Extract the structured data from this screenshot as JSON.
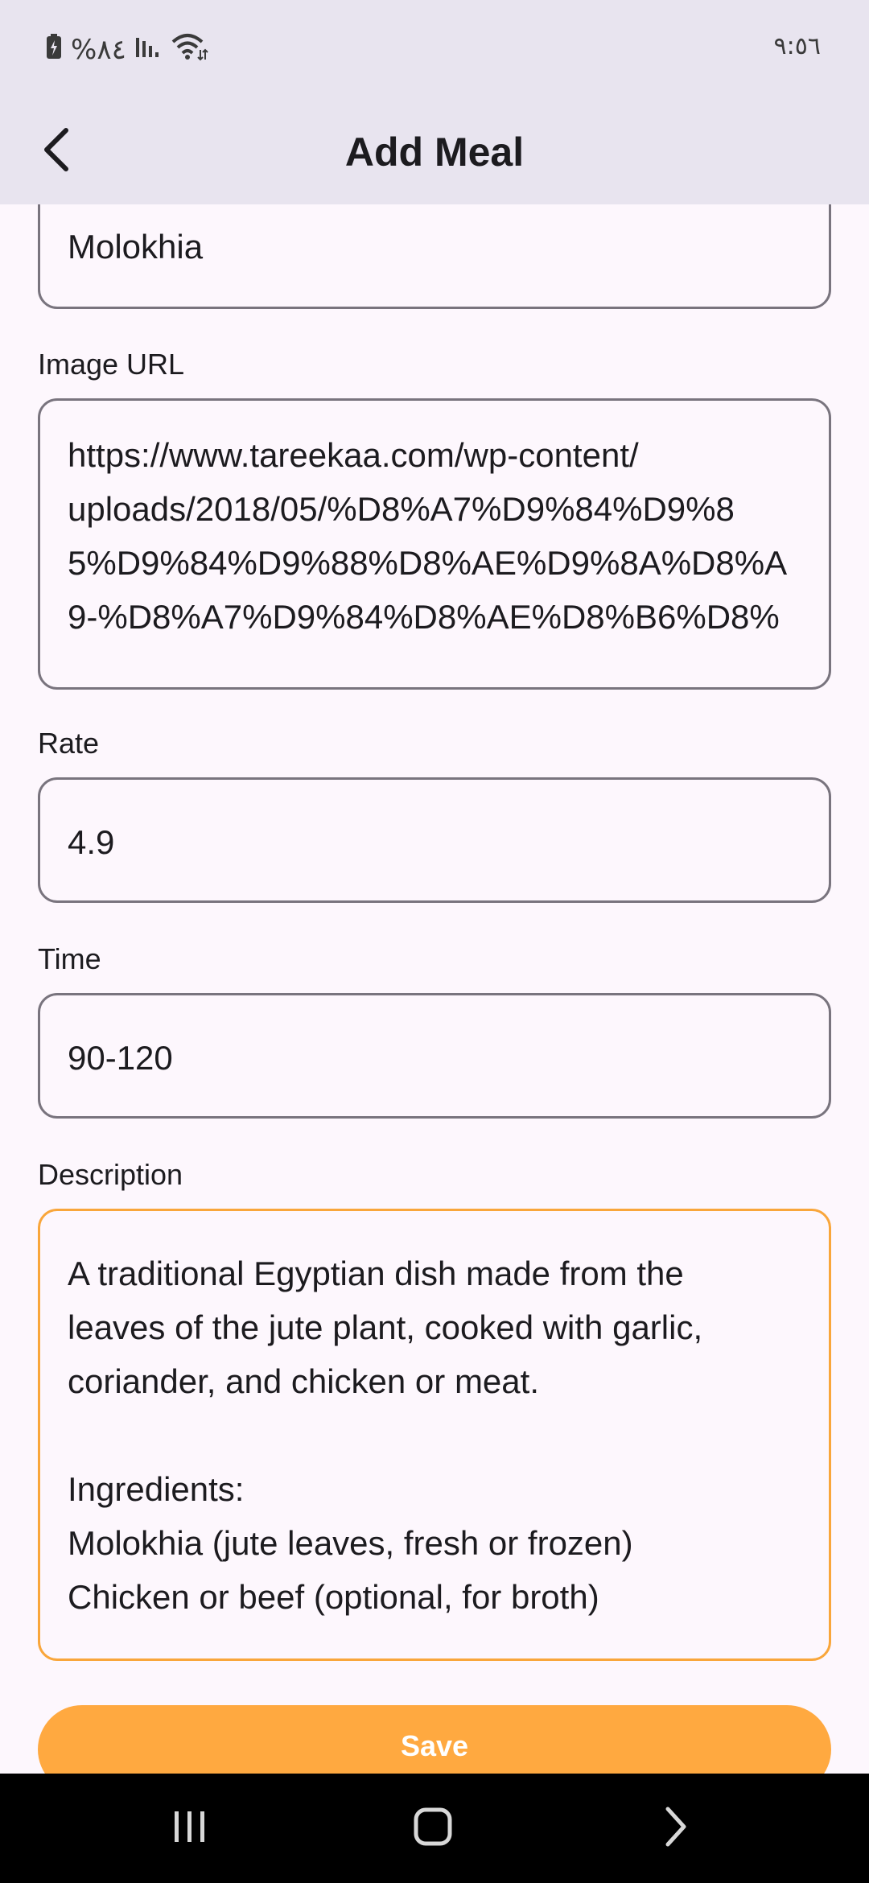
{
  "status_bar": {
    "battery_percent": "%٨٤",
    "time": "٩:٥٦",
    "icons": [
      "battery-charging-icon",
      "signal-icon",
      "wifi-icon"
    ]
  },
  "app_bar": {
    "title": "Add Meal",
    "back_icon": "chevron-left-icon"
  },
  "form": {
    "name_value": "Molokhia",
    "image_url": {
      "label": "Image URL",
      "value": "https://www.tareekaa.com/wp-content/\nuploads/2018/05/%D8%A7%D9%84%D9%8\n5%D9%84%D9%88%D8%AE%D9%8A%D8%A\n9-%D8%A7%D9%84%D8%AE%D8%B6%D8%"
    },
    "rate": {
      "label": "Rate",
      "value": "4.9"
    },
    "time": {
      "label": "Time",
      "value": "90-120"
    },
    "description": {
      "label": "Description",
      "value": "A traditional Egyptian dish made from the\nleaves of the jute plant, cooked with garlic,\ncoriander, and chicken or meat.\n\nIngredients:\nMolokhia (jute leaves, fresh or frozen)\nChicken or beef (optional, for broth)"
    },
    "save_label": "Save"
  },
  "colors": {
    "accent": "#ffa940",
    "focus_border": "#f9a63b",
    "app_bar_bg": "#e8e4ef",
    "page_bg": "#fdf7fd"
  },
  "nav_bar": {
    "icons": [
      "recent-apps-icon",
      "home-icon",
      "back-icon"
    ]
  }
}
